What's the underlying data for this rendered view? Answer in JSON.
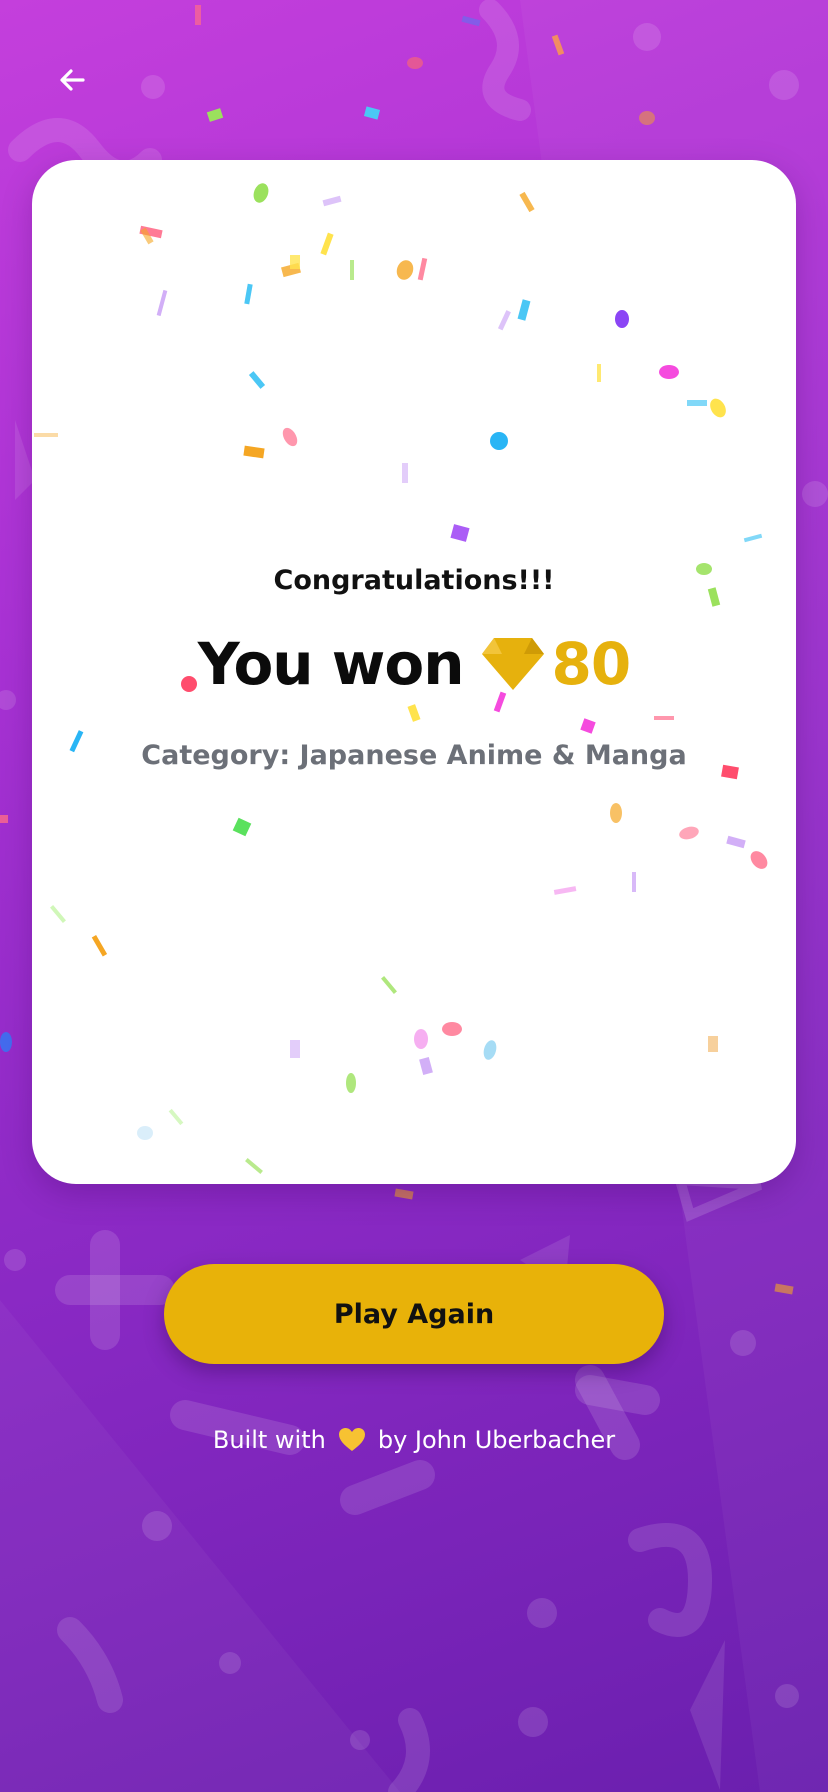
{
  "nav": {
    "back_label": "Back"
  },
  "result": {
    "title": "Congratulations!!!",
    "won_label": "You won",
    "amount": "80",
    "category": "Category: Japanese Anime & Manga"
  },
  "actions": {
    "play_again_label": "Play Again"
  },
  "footer": {
    "prefix": "Built with",
    "icon": "yellow-heart-icon",
    "suffix": "by John Uberbacher"
  },
  "colors": {
    "accent": "#e8b209",
    "gem": "#e6b10d",
    "card": "#ffffff",
    "category_text": "#6c7078"
  }
}
